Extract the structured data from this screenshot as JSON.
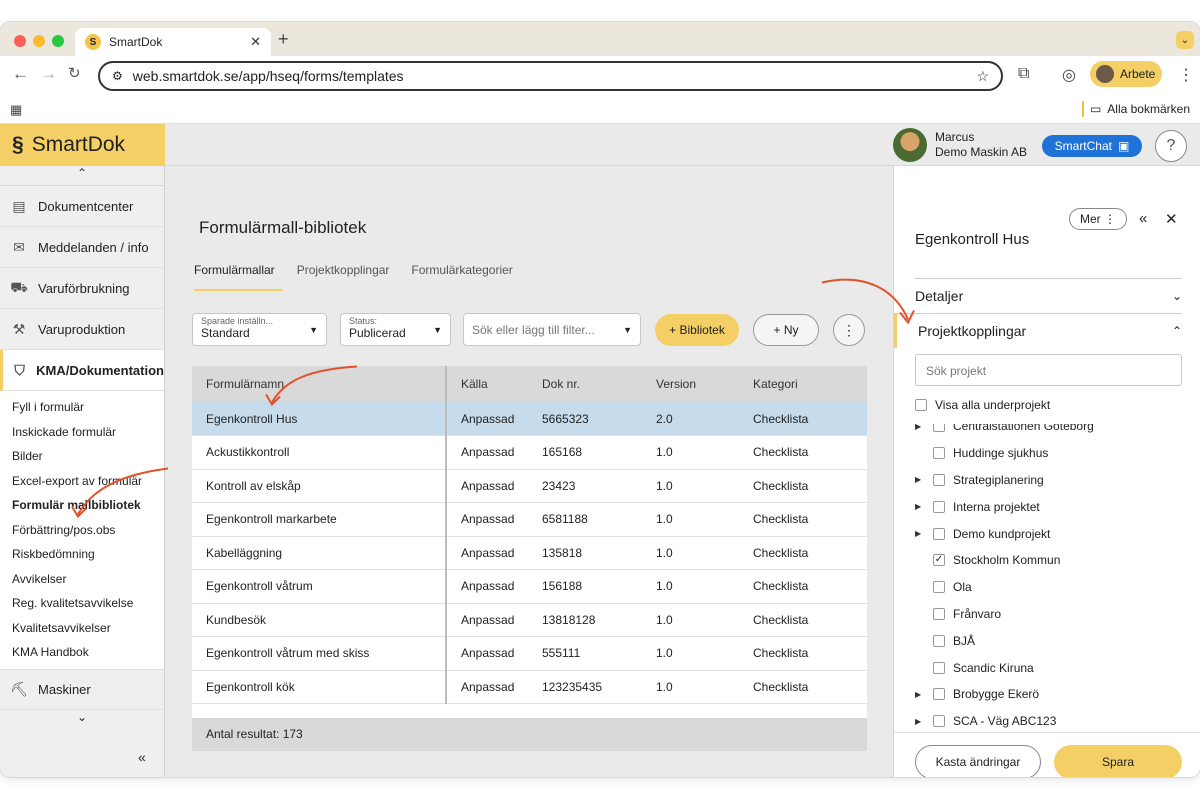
{
  "browser": {
    "tab_title": "SmartDok",
    "url": "web.smartdok.se/app/hseq/forms/templates",
    "profile_label": "Arbete",
    "bookmark_folder": "Alla bokmärken"
  },
  "app": {
    "logo_text": "SmartDok",
    "user_name": "Marcus",
    "user_company": "Demo Maskin AB",
    "chat_label": "SmartChat",
    "help_label": "?"
  },
  "sidebar": {
    "items": [
      {
        "label": "Dokumentcenter"
      },
      {
        "label": "Meddelanden / info"
      },
      {
        "label": "Varuförbrukning"
      },
      {
        "label": "Varuproduktion"
      },
      {
        "label": "KMA/Dokumentation"
      }
    ],
    "sub": [
      "Fyll i formulär",
      "Inskickade formulär",
      "Bilder",
      "Excel-export av formulär",
      "Formulär mallbibliotek",
      "Förbättring/pos.obs",
      "Riskbedömning",
      "Avvikelser",
      "Reg. kvalitetsavvikelse",
      "Kvalitetsavvikelser",
      "KMA Handbok"
    ],
    "last_item": "Maskiner"
  },
  "main": {
    "title": "Formulärmall-bibliotek",
    "tabs": [
      "Formulärmallar",
      "Projektkopplingar",
      "Formulärkategorier"
    ],
    "saved_label": "Sparade inställn...",
    "saved_value": "Standard",
    "status_label": "Status:",
    "status_value": "Publicerad",
    "filter_placeholder": "Sök eller lägg till filter...",
    "btn_bibliotek": "+ Bibliotek",
    "btn_ny": "+ Ny",
    "btn_more": "⋮",
    "columns": [
      "Formulärnamn",
      "Källa",
      "Dok nr.",
      "Version",
      "Kategori"
    ],
    "rows": [
      [
        "Egenkontroll Hus",
        "Anpassad",
        "5665323",
        "2.0",
        "Checklista"
      ],
      [
        "Ackustikkontroll",
        "Anpassad",
        "165168",
        "1.0",
        "Checklista"
      ],
      [
        "Kontroll av elskåp",
        "Anpassad",
        "23423",
        "1.0",
        "Checklista"
      ],
      [
        "Egenkontroll markarbete",
        "Anpassad",
        "6581188",
        "1.0",
        "Checklista"
      ],
      [
        "Kabelläggning",
        "Anpassad",
        "135818",
        "1.0",
        "Checklista"
      ],
      [
        "Egenkontroll våtrum",
        "Anpassad",
        "156188",
        "1.0",
        "Checklista"
      ],
      [
        "Kundbesök",
        "Anpassad",
        "13818128",
        "1.0",
        "Checklista"
      ],
      [
        "Egenkontroll våtrum med skiss",
        "Anpassad",
        "555111",
        "1.0",
        "Checklista"
      ],
      [
        "Egenkontroll kök",
        "Anpassad",
        "123235435",
        "1.0",
        "Checklista"
      ]
    ],
    "result_text": "Antal resultat: 173"
  },
  "panel": {
    "more_label": "Mer ⋮",
    "title": "Egenkontroll Hus",
    "details_label": "Detaljer",
    "links_label": "Projektkopplingar",
    "search_placeholder": "Sök projekt",
    "show_all_label": "Visa alla underprojekt",
    "projects": [
      {
        "name": "Centralstationen Göteborg",
        "expand": true,
        "checked": false
      },
      {
        "name": "Huddinge sjukhus",
        "expand": false,
        "checked": false
      },
      {
        "name": "Strategiplanering",
        "expand": true,
        "checked": false
      },
      {
        "name": "Interna projektet",
        "expand": true,
        "checked": false
      },
      {
        "name": "Demo kundprojekt",
        "expand": true,
        "checked": false
      },
      {
        "name": "Stockholm Kommun",
        "expand": false,
        "checked": true
      },
      {
        "name": "Ola",
        "expand": false,
        "checked": false
      },
      {
        "name": "Frånvaro",
        "expand": false,
        "checked": false
      },
      {
        "name": "BJÅ",
        "expand": false,
        "checked": false
      },
      {
        "name": "Scandic Kiruna",
        "expand": false,
        "checked": false
      },
      {
        "name": "Brobygge Ekerö",
        "expand": true,
        "checked": false
      },
      {
        "name": "SCA - Väg ABC123",
        "expand": true,
        "checked": false
      }
    ],
    "discard_label": "Kasta ändringar",
    "save_label": "Spara"
  },
  "colors": {
    "accent": "#f4cf66",
    "selected_row": "#c6dced",
    "arrow": "#e0522a",
    "chat_blue": "#1f73d8"
  }
}
